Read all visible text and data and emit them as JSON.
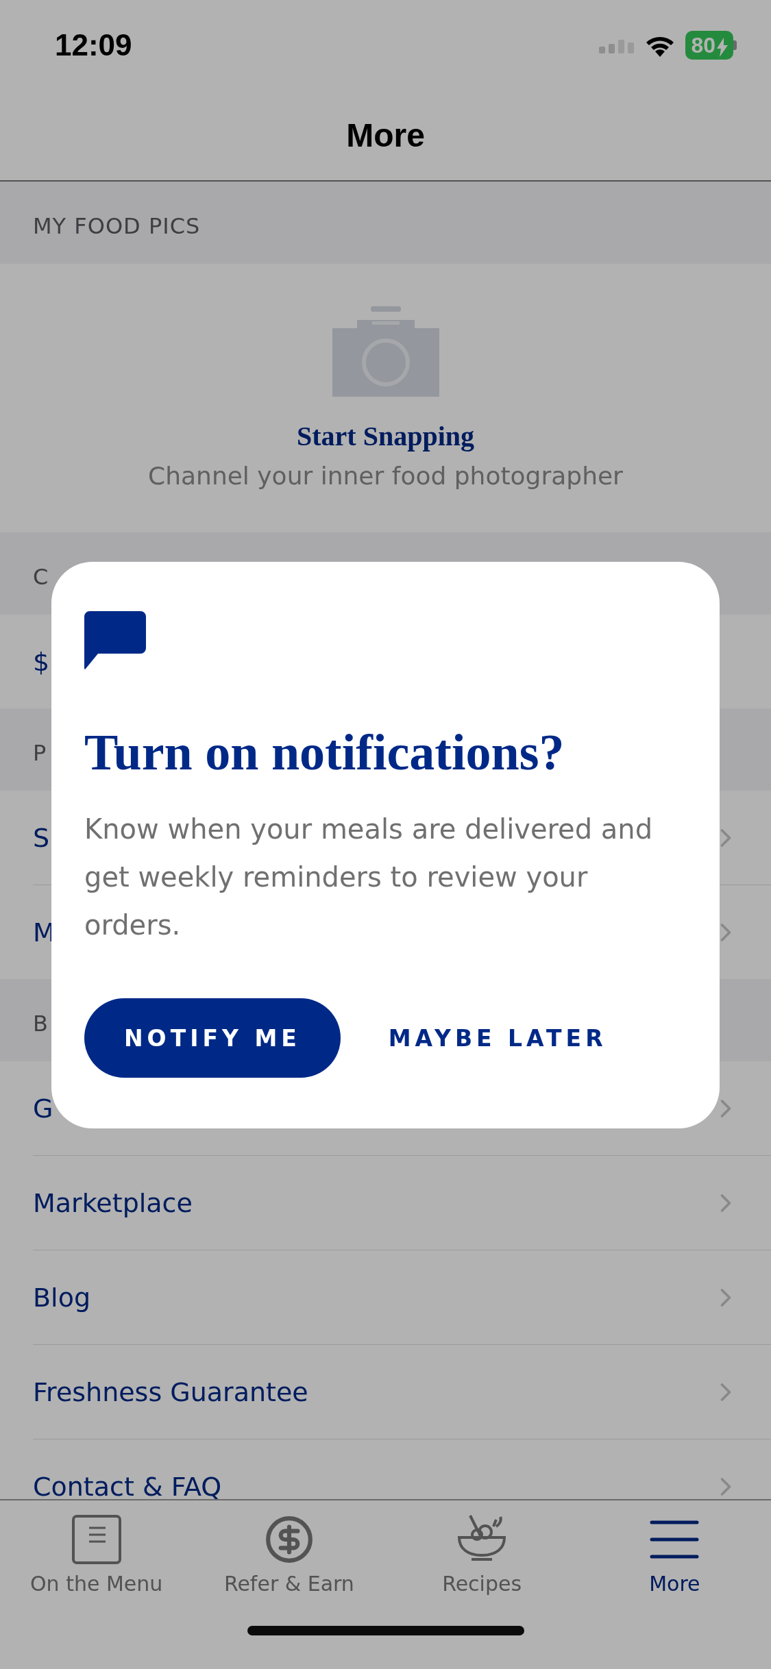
{
  "status_bar": {
    "time": "12:09",
    "battery": "80"
  },
  "header": {
    "title": "More"
  },
  "sections": [
    {
      "kind": "photos",
      "heading": "MY FOOD PICS",
      "title": "Start Snapping",
      "subtitle": "Channel your inner food photographer"
    },
    {
      "kind": "list",
      "heading": "C",
      "rows": [
        {
          "label": "$",
          "chevron": false
        }
      ]
    },
    {
      "kind": "list",
      "heading": "P",
      "rows": [
        {
          "label": "S",
          "chevron": true
        },
        {
          "label": "M",
          "chevron": true
        }
      ]
    },
    {
      "kind": "list",
      "heading": "B",
      "rows": [
        {
          "label": "G",
          "chevron": true
        },
        {
          "label": "Marketplace",
          "chevron": true
        },
        {
          "label": "Blog",
          "chevron": true
        },
        {
          "label": "Freshness Guarantee",
          "chevron": true
        },
        {
          "label": "Contact & FAQ",
          "chevron": true
        }
      ]
    }
  ],
  "dialog": {
    "title": "Turn on notifications?",
    "body": "Know when your meals are delivered and get weekly reminders to review your orders.",
    "buttons": [
      {
        "label": "NOTIFY ME",
        "kind": "primary"
      },
      {
        "label": "MAYBE LATER",
        "kind": "text"
      }
    ]
  },
  "tabs": [
    {
      "label": "On the Menu",
      "kind": "menu-card",
      "selected": false
    },
    {
      "label": "Refer & Earn",
      "kind": "dollar",
      "selected": false
    },
    {
      "label": "Recipes",
      "kind": "bowl",
      "selected": false
    },
    {
      "label": "More",
      "kind": "hamburger",
      "selected": true
    }
  ]
}
